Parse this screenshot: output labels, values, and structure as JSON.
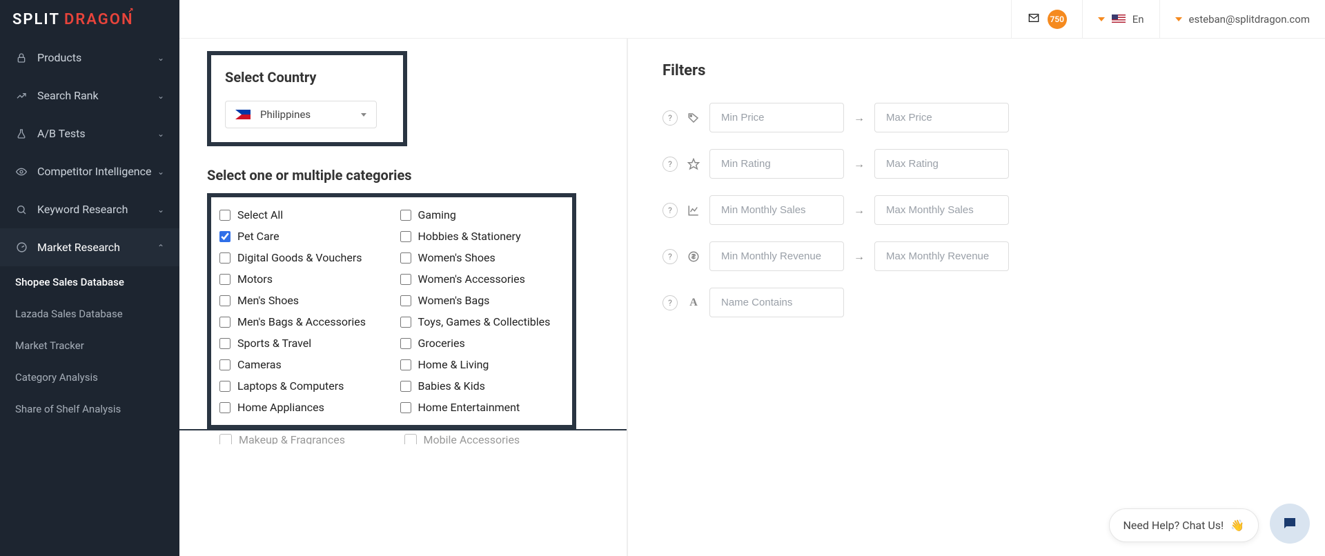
{
  "brand": {
    "part1": "SPLIT",
    "part2": "DRAGON"
  },
  "topbar": {
    "messages_count": "750",
    "lang": "En",
    "user_email": "esteban@splitdragon.com"
  },
  "sidebar": {
    "items": [
      {
        "label": "Products"
      },
      {
        "label": "Search Rank"
      },
      {
        "label": "A/B Tests"
      },
      {
        "label": "Competitor Intelligence"
      },
      {
        "label": "Keyword Research"
      },
      {
        "label": "Market Research"
      }
    ],
    "sub_items": [
      {
        "label": "Shopee Sales Database",
        "active": true
      },
      {
        "label": "Lazada Sales Database"
      },
      {
        "label": "Market Tracker"
      },
      {
        "label": "Category Analysis"
      },
      {
        "label": "Share of Shelf Analysis"
      }
    ]
  },
  "country_panel": {
    "heading": "Select Country",
    "selected": "Philippines"
  },
  "categories_panel": {
    "heading": "Select one or multiple categories",
    "col1": [
      {
        "label": "Select All",
        "checked": false
      },
      {
        "label": "Pet Care",
        "checked": true
      },
      {
        "label": "Digital Goods & Vouchers",
        "checked": false
      },
      {
        "label": "Motors",
        "checked": false
      },
      {
        "label": "Men's Shoes",
        "checked": false
      },
      {
        "label": "Men's Bags & Accessories",
        "checked": false
      },
      {
        "label": "Sports & Travel",
        "checked": false
      },
      {
        "label": "Cameras",
        "checked": false
      },
      {
        "label": "Laptops & Computers",
        "checked": false
      },
      {
        "label": "Home Appliances",
        "checked": false
      }
    ],
    "col2": [
      {
        "label": "Gaming",
        "checked": false
      },
      {
        "label": "Hobbies & Stationery",
        "checked": false
      },
      {
        "label": "Women's Shoes",
        "checked": false
      },
      {
        "label": "Women's Accessories",
        "checked": false
      },
      {
        "label": "Women's Bags",
        "checked": false
      },
      {
        "label": "Toys, Games & Collectibles",
        "checked": false
      },
      {
        "label": "Groceries",
        "checked": false
      },
      {
        "label": "Home & Living",
        "checked": false
      },
      {
        "label": "Babies & Kids",
        "checked": false
      },
      {
        "label": "Home Entertainment",
        "checked": false
      }
    ],
    "overflow_col1": "Makeup & Fragrances",
    "overflow_col2": "Mobile Accessories"
  },
  "filters_panel": {
    "heading": "Filters",
    "rows": [
      {
        "icon": "tag-icon",
        "min_ph": "Min Price",
        "max_ph": "Max Price"
      },
      {
        "icon": "star-icon",
        "min_ph": "Min Rating",
        "max_ph": "Max Rating"
      },
      {
        "icon": "chart-icon",
        "min_ph": "Min Monthly Sales",
        "max_ph": "Max Monthly Sales"
      },
      {
        "icon": "dollar-icon",
        "min_ph": "Min Monthly Revenue",
        "max_ph": "Max Monthly Revenue"
      }
    ],
    "name_row": {
      "icon": "text-icon",
      "ph": "Name Contains"
    }
  },
  "chat": {
    "label": "Need Help? Chat Us!"
  }
}
